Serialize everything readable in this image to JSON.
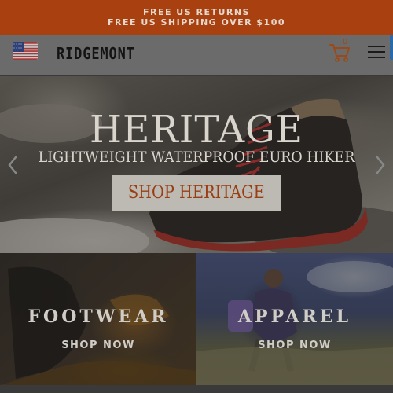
{
  "promo": {
    "line1": "FREE US RETURNS",
    "line2": "FREE US SHIPPING OVER $100"
  },
  "header": {
    "flag_icon": "us-flag-icon",
    "logo": "RIDGEMONT",
    "cart_icon": "cart-icon",
    "cart_count": "0",
    "menu_icon": "hamburger-menu-icon"
  },
  "hero": {
    "title": "HERITAGE",
    "subtitle": "LIGHTWEIGHT WATERPROOF EURO HIKER",
    "cta_label": "SHOP HERITAGE",
    "prev_icon": "chevron-left-icon",
    "next_icon": "chevron-right-icon"
  },
  "categories": [
    {
      "title": "FOOTWEAR",
      "cta": "SHOP NOW"
    },
    {
      "title": "APPAREL",
      "cta": "SHOP NOW"
    }
  ],
  "colors": {
    "promo_bg": "#a84010",
    "accent": "#9a3d12"
  }
}
